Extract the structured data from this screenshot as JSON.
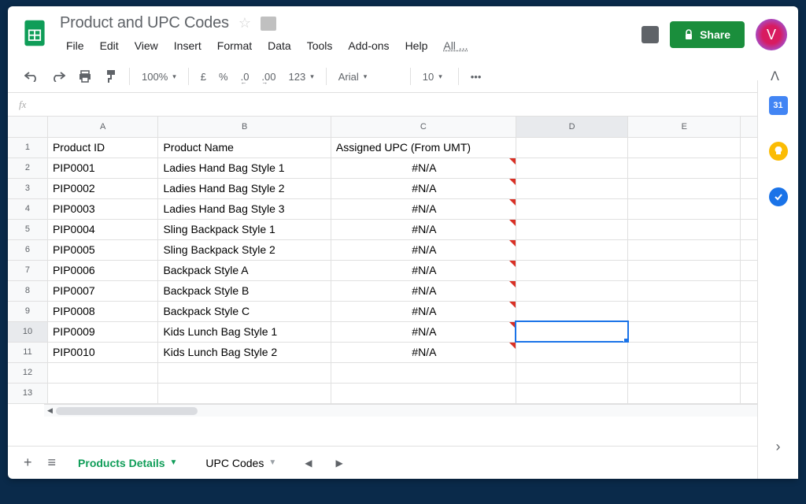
{
  "doc": {
    "title": "Product and UPC Codes"
  },
  "menu": {
    "file": "File",
    "edit": "Edit",
    "view": "View",
    "insert": "Insert",
    "format": "Format",
    "data": "Data",
    "tools": "Tools",
    "addons": "Add-ons",
    "help": "Help",
    "all": "All ..."
  },
  "share": {
    "label": "Share"
  },
  "avatar": {
    "letter": "V"
  },
  "toolbar": {
    "zoom": "100%",
    "currency": "£",
    "percent": "%",
    "dec_less": ".0",
    "dec_more": ".00",
    "numfmt": "123",
    "font": "Arial",
    "size": "10",
    "more": "•••"
  },
  "formula": {
    "fx": "fx",
    "value": ""
  },
  "columns": [
    "A",
    "B",
    "C",
    "D",
    "E"
  ],
  "rows": [
    "1",
    "2",
    "3",
    "4",
    "5",
    "6",
    "7",
    "8",
    "9",
    "10",
    "11",
    "12",
    "13"
  ],
  "headers": {
    "a": "Product ID",
    "b": "Product Name",
    "c": "Assigned UPC (From UMT)"
  },
  "data": [
    {
      "id": "PIP0001",
      "name": "Ladies Hand Bag Style 1",
      "upc": "#N/A"
    },
    {
      "id": "PIP0002",
      "name": "Ladies Hand Bag Style 2",
      "upc": "#N/A"
    },
    {
      "id": "PIP0003",
      "name": "Ladies Hand Bag Style 3",
      "upc": "#N/A"
    },
    {
      "id": "PIP0004",
      "name": "Sling Backpack Style 1",
      "upc": "#N/A"
    },
    {
      "id": "PIP0005",
      "name": "Sling Backpack Style 2",
      "upc": "#N/A"
    },
    {
      "id": "PIP0006",
      "name": "Backpack Style A",
      "upc": "#N/A"
    },
    {
      "id": "PIP0007",
      "name": "Backpack Style B",
      "upc": "#N/A"
    },
    {
      "id": "PIP0008",
      "name": "Backpack Style C",
      "upc": "#N/A"
    },
    {
      "id": "PIP0009",
      "name": "Kids Lunch Bag Style 1",
      "upc": "#N/A"
    },
    {
      "id": "PIP0010",
      "name": "Kids Lunch Bag Style 2",
      "upc": "#N/A"
    }
  ],
  "selected_cell": "D10",
  "tabs": {
    "active": "Products Details",
    "other": "UPC Codes"
  },
  "side": {
    "cal": "31"
  }
}
